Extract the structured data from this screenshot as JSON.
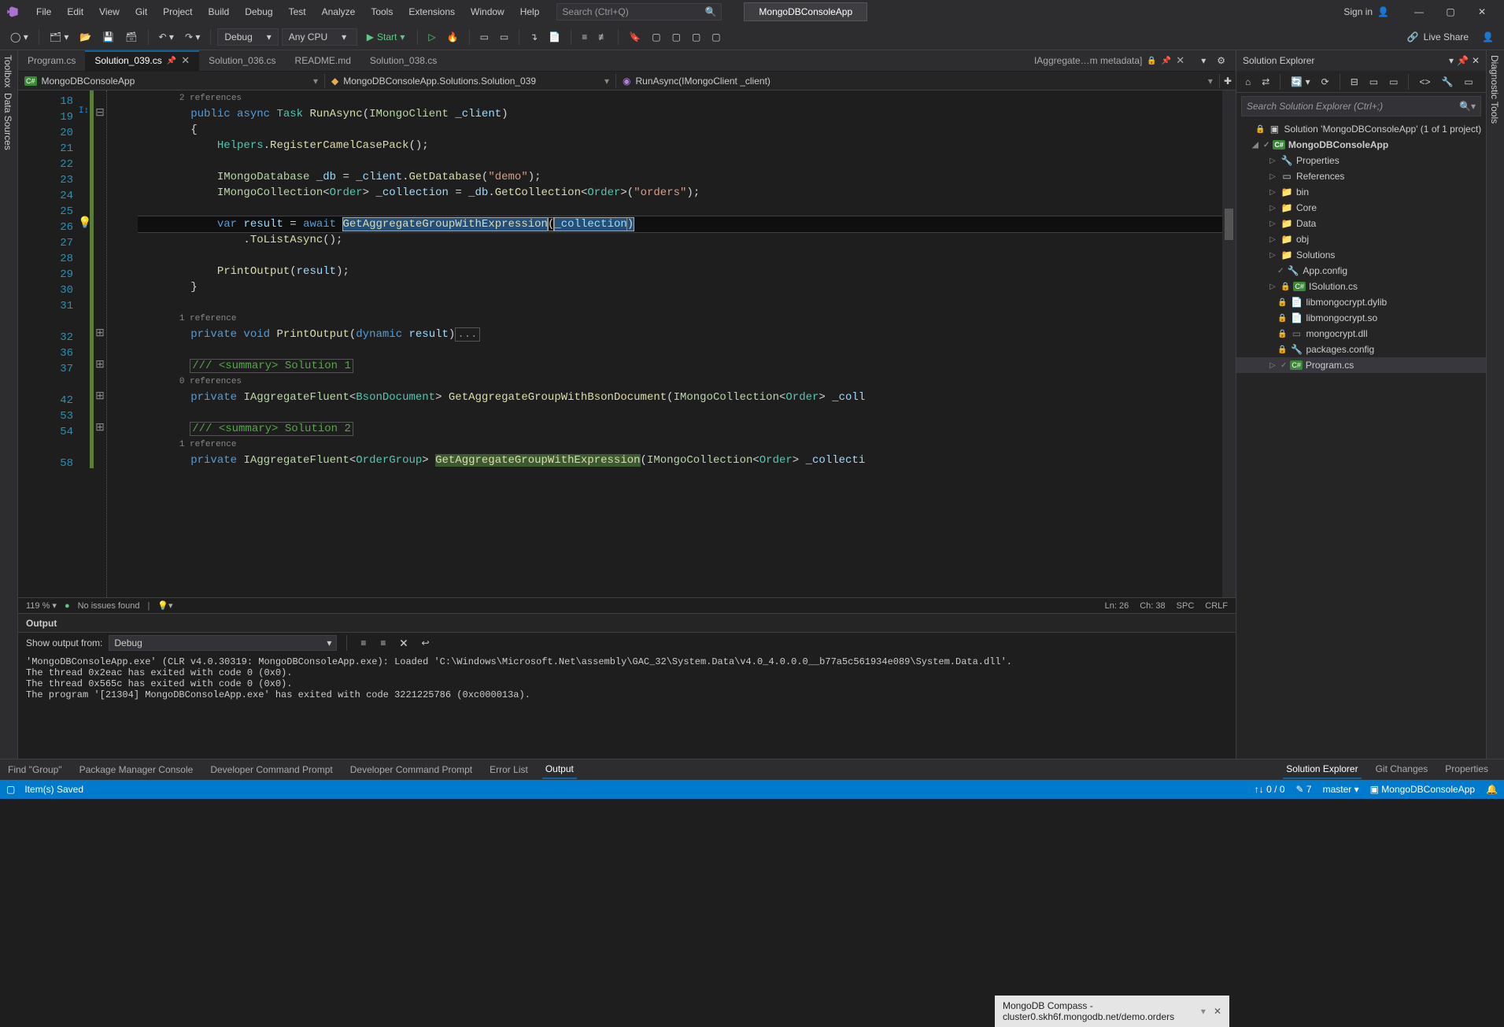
{
  "titlebar": {
    "menus": [
      "File",
      "Edit",
      "View",
      "Git",
      "Project",
      "Build",
      "Debug",
      "Test",
      "Analyze",
      "Tools",
      "Extensions",
      "Window",
      "Help"
    ],
    "search_placeholder": "Search (Ctrl+Q)",
    "app_button": "MongoDBConsoleApp",
    "signin": "Sign in",
    "win_min": "—",
    "win_max": "▢",
    "win_close": "✕"
  },
  "toolbar": {
    "config": "Debug",
    "platform": "Any CPU",
    "start": "Start",
    "liveshare": "Live Share"
  },
  "vtabs": {
    "left1": "Toolbox",
    "left2": "Data Sources",
    "right1": "Diagnostic Tools"
  },
  "tabs": {
    "t0": "Program.cs",
    "t1": "Solution_039.cs",
    "t2": "Solution_036.cs",
    "t3": "README.md",
    "t4": "Solution_038.cs",
    "right": "IAggregate…m metadata]"
  },
  "nav": {
    "left": "MongoDBConsoleApp",
    "mid": "MongoDBConsoleApp.Solutions.Solution_039",
    "right": "RunAsync(IMongoClient _client)"
  },
  "gutter": {
    "l18": "18",
    "l19": "19",
    "l20": "20",
    "l21": "21",
    "l22": "22",
    "l23": "23",
    "l24": "24",
    "l25": "25",
    "l26": "26",
    "l27": "27",
    "l28": "28",
    "l29": "29",
    "l30": "30",
    "l31": "31",
    "l32": "32",
    "l36": "36",
    "l37": "37",
    "l42": "42",
    "l53": "53",
    "l54": "54",
    "l58": "58"
  },
  "code": {
    "refs2": "2 references",
    "l19a": "public",
    "l19b": " async ",
    "l19c": "Task",
    "l19d": " RunAsync",
    "l19e": "(",
    "l19f": "IMongoClient",
    "l19g": " _client",
    "l19h": ")",
    "l20": "{",
    "l21a": "Helpers",
    "l21b": ".",
    "l21c": "RegisterCamelCasePack",
    "l21d": "();",
    "l23a": "IMongoDatabase",
    "l23b": " _db ",
    "l23c": "= ",
    "l23d": "_client",
    "l23e": ".",
    "l23f": "GetDatabase",
    "l23g": "(",
    "l23h": "\"demo\"",
    "l23i": ");",
    "l24a": "IMongoCollection",
    "l24b": "<",
    "l24c": "Order",
    "l24d": "> ",
    "l24e": "_collection ",
    "l24f": "= ",
    "l24g": "_db",
    "l24h": ".",
    "l24i": "GetCollection",
    "l24j": "<",
    "l24k": "Order",
    "l24l": ">(",
    "l24m": "\"orders\"",
    "l24n": ");",
    "l26a": "var",
    "l26b": " result ",
    "l26c": "= ",
    "l26d": "await",
    "l26e": " ",
    "l26f": "GetAggregateGroupWithExpression",
    "l26g": "(",
    "l26h": "_collection",
    "l26i": ")",
    "l27a": ".",
    "l27b": "ToListAsync",
    "l27c": "();",
    "l29a": "PrintOutput",
    "l29b": "(",
    "l29c": "result",
    "l29d": ");",
    "l30": "}",
    "refs1": "1 reference",
    "l32a": "private",
    "l32b": " void ",
    "l32c": "PrintOutput",
    "l32d": "(",
    "l32e": "dynamic",
    "l32f": " result",
    "l32g": ")",
    "l32h": "...",
    "l37a": "/// <summary> Solution 1",
    "refs0": "0 references",
    "l42a": "private",
    "l42b": " ",
    "l42c": "IAggregateFluent",
    "l42d": "<",
    "l42e": "BsonDocument",
    "l42f": "> ",
    "l42g": "GetAggregateGroupWithBsonDocument",
    "l42h": "(",
    "l42i": "IMongoCollection",
    "l42j": "<",
    "l42k": "Order",
    "l42l": "> ",
    "l42m": "_coll",
    "l54a": "/// <summary> Solution 2",
    "refs1b": "1 reference",
    "l58a": "private",
    "l58b": " ",
    "l58c": "IAggregateFluent",
    "l58d": "<",
    "l58e": "OrderGroup",
    "l58f": "> ",
    "l58g": "GetAggregateGroupWithExpression",
    "l58h": "(",
    "l58i": "IMongoCollection",
    "l58j": "<",
    "l58k": "Order",
    "l58l": "> ",
    "l58m": "_collecti"
  },
  "ed_status": {
    "zoom": "119 %",
    "noissues": "No issues found",
    "ln": "Ln: 26",
    "ch": "Ch: 38",
    "spc": "SPC",
    "crlf": "CRLF"
  },
  "output": {
    "title": "Output",
    "from": "Show output from:",
    "source": "Debug",
    "body": "'MongoDBConsoleApp.exe' (CLR v4.0.30319: MongoDBConsoleApp.exe): Loaded 'C:\\Windows\\Microsoft.Net\\assembly\\GAC_32\\System.Data\\v4.0_4.0.0.0__b77a5c561934e089\\System.Data.dll'.\nThe thread 0x2eac has exited with code 0 (0x0).\nThe thread 0x565c has exited with code 0 (0x0).\nThe program '[21304] MongoDBConsoleApp.exe' has exited with code 3221225786 (0xc000013a)."
  },
  "popup": {
    "text": "MongoDB Compass - cluster0.skh6f.mongodb.net/demo.orders"
  },
  "bottomtabs": {
    "t0": "Find \"Group\"",
    "t1": "Package Manager Console",
    "t2": "Developer Command Prompt",
    "t3": "Developer Command Prompt",
    "t4": "Error List",
    "t5": "Output",
    "r0": "Solution Explorer",
    "r1": "Git Changes",
    "r2": "Properties"
  },
  "status": {
    "left": "Item(s) Saved",
    "errs": "0 / 0",
    "changes": "7",
    "branch": "master",
    "repo": "MongoDBConsoleApp"
  },
  "side": {
    "title": "Solution Explorer",
    "search": "Search Solution Explorer (Ctrl+;)",
    "sln": "Solution 'MongoDBConsoleApp' (1 of 1 project)",
    "proj": "MongoDBConsoleApp",
    "props": "Properties",
    "refs": "References",
    "bin": "bin",
    "core": "Core",
    "data": "Data",
    "obj": "obj",
    "solutions": "Solutions",
    "appcfg": "App.config",
    "isol": "ISolution.cs",
    "lm1": "libmongocrypt.dylib",
    "lm2": "libmongocrypt.so",
    "lm3": "mongocrypt.dll",
    "pkg": "packages.config",
    "prog": "Program.cs"
  }
}
